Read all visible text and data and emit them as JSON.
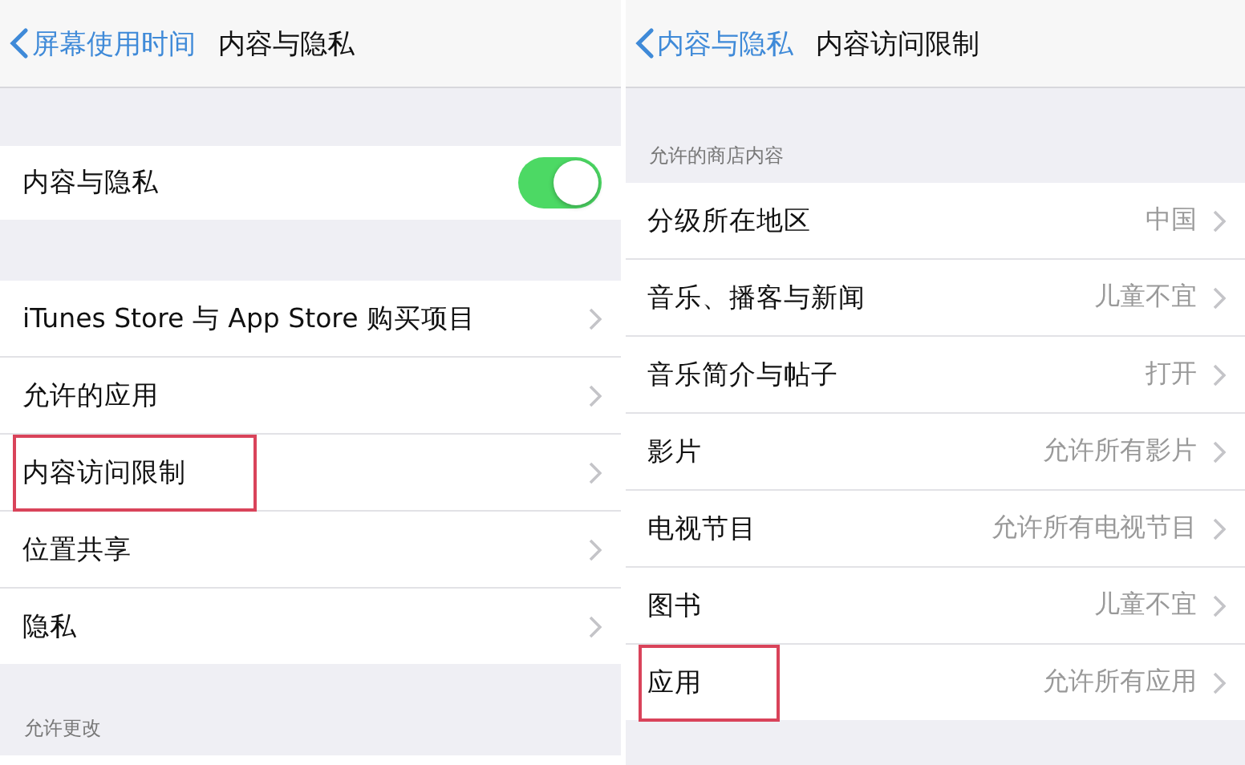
{
  "panels": [
    {
      "nav": {
        "back": "屏幕使用时间",
        "title": "内容与隐私"
      },
      "groups": [
        {
          "rows": [
            {
              "kind": "toggle",
              "label": "内容与隐私",
              "on": true,
              "highlighted": false
            }
          ]
        },
        {
          "rows": [
            {
              "kind": "link",
              "label": "iTunes Store 与 App Store 购买项目",
              "highlighted": false
            },
            {
              "kind": "link",
              "label": "允许的应用",
              "highlighted": false
            },
            {
              "kind": "link",
              "label": "内容访问限制",
              "highlighted": true
            },
            {
              "kind": "link",
              "label": "位置共享",
              "highlighted": false
            },
            {
              "kind": "link",
              "label": "隐私",
              "highlighted": false
            }
          ]
        },
        {
          "header": "允许更改"
        }
      ]
    },
    {
      "nav": {
        "back": "内容与隐私",
        "title": "内容访问限制"
      },
      "groups": [
        {
          "header": "允许的商店内容",
          "rows": [
            {
              "kind": "link",
              "label": "分级所在地区",
              "value": "中国",
              "highlighted": false
            },
            {
              "kind": "link",
              "label": "音乐、播客与新闻",
              "value": "儿童不宜",
              "highlighted": false
            },
            {
              "kind": "link",
              "label": "音乐简介与帖子",
              "value": "打开",
              "highlighted": false
            },
            {
              "kind": "link",
              "label": "影片",
              "value": "允许所有影片",
              "highlighted": false
            },
            {
              "kind": "link",
              "label": "电视节目",
              "value": "允许所有电视节目",
              "highlighted": false
            },
            {
              "kind": "link",
              "label": "图书",
              "value": "儿童不宜",
              "highlighted": false
            },
            {
              "kind": "link",
              "label": "应用",
              "value": "允许所有应用",
              "highlighted": true
            }
          ]
        }
      ]
    }
  ]
}
